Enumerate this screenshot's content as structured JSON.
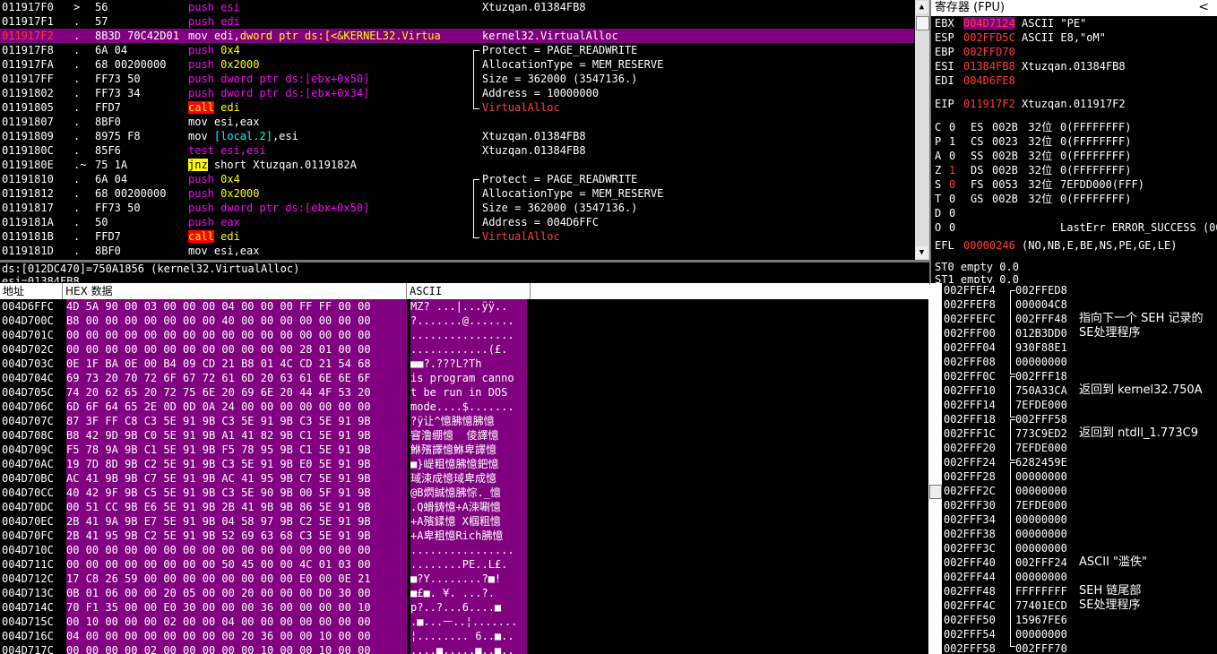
{
  "colors": {
    "selection": "#800080",
    "push": "#ff00ff",
    "arg": "#ffff00",
    "call_bg": "#ff0000",
    "reg_changed": "#ff3b3b"
  },
  "disasm": {
    "rows": [
      {
        "addr": "011917F0",
        "mk": ">",
        "hex": "56",
        "asm": [
          {
            "t": "push",
            "k": "push"
          },
          {
            "t": " esi",
            "k": "push"
          }
        ],
        "cmt": "Xtuzqan.01384FB8"
      },
      {
        "addr": "011917F1",
        "mk": ".",
        "hex": "57",
        "asm": [
          {
            "t": "push",
            "k": "push"
          },
          {
            "t": " edi",
            "k": "push"
          }
        ],
        "cmt": ""
      },
      {
        "addr": "011917F2",
        "mk": ".",
        "hex": "8B3D 70C42D01",
        "asm": [
          {
            "t": "mov edi,",
            "k": "mov"
          },
          {
            "t": "dword ptr ds:[<&KERNEL32.Virtua",
            "k": "mem"
          }
        ],
        "cmt": "kernel32.VirtualAlloc",
        "sel": true
      },
      {
        "addr": "011917F8",
        "mk": ".",
        "hex": "6A 04",
        "asm": [
          {
            "t": "push",
            "k": "push"
          },
          {
            "t": " 0x4",
            "k": "arg"
          }
        ],
        "cmt": "Protect = PAGE_READWRITE"
      },
      {
        "addr": "011917FA",
        "mk": ".",
        "hex": "68 00200000",
        "asm": [
          {
            "t": "push",
            "k": "push"
          },
          {
            "t": " 0x2000",
            "k": "arg"
          }
        ],
        "cmt": "AllocationType = MEM_RESERVE"
      },
      {
        "addr": "011917FF",
        "mk": ".",
        "hex": "FF73 50",
        "asm": [
          {
            "t": "push",
            "k": "push"
          },
          {
            "t": " dword ptr ds:[ebx+0x50]",
            "k": "push"
          }
        ],
        "cmt": "Size = 362000 (3547136.)"
      },
      {
        "addr": "01191802",
        "mk": ".",
        "hex": "FF73 34",
        "asm": [
          {
            "t": "push",
            "k": "push"
          },
          {
            "t": " dword ptr ds:[ebx+0x34]",
            "k": "push"
          }
        ],
        "cmt": "Address = 10000000"
      },
      {
        "addr": "01191805",
        "mk": ".",
        "hex": "FFD7",
        "asm": [
          {
            "t": "call",
            "k": "call"
          },
          {
            "t": " edi",
            "k": "arg"
          }
        ],
        "cmt": "VirtualAlloc",
        "cmtred": true
      },
      {
        "addr": "01191807",
        "mk": ".",
        "hex": "8BF0",
        "asm": [
          {
            "t": "mov esi,eax",
            "k": "mov"
          }
        ],
        "cmt": ""
      },
      {
        "addr": "01191809",
        "mk": ".",
        "hex": "8975 F8",
        "asm": [
          {
            "t": "mov ",
            "k": "mov"
          },
          {
            "t": "[local.2]",
            "k": "reg"
          },
          {
            "t": ",esi",
            "k": "mov"
          }
        ],
        "cmt": "Xtuzqan.01384FB8"
      },
      {
        "addr": "0119180C",
        "mk": ".",
        "hex": "85F6",
        "asm": [
          {
            "t": "test esi,esi",
            "k": "test"
          }
        ],
        "cmt": "Xtuzqan.01384FB8"
      },
      {
        "addr": "0119180E",
        "mk": ".~",
        "hex": "75 1A",
        "asm": [
          {
            "t": "jnz",
            "k": "jnz"
          },
          {
            "t": " short Xtuzqan.0119182A",
            "k": "mov"
          }
        ],
        "cmt": ""
      },
      {
        "addr": "01191810",
        "mk": ".",
        "hex": "6A 04",
        "asm": [
          {
            "t": "push",
            "k": "push"
          },
          {
            "t": " 0x4",
            "k": "arg"
          }
        ],
        "cmt": "Protect = PAGE_READWRITE"
      },
      {
        "addr": "01191812",
        "mk": ".",
        "hex": "68 00200000",
        "asm": [
          {
            "t": "push",
            "k": "push"
          },
          {
            "t": " 0x2000",
            "k": "arg"
          }
        ],
        "cmt": "AllocationType = MEM_RESERVE"
      },
      {
        "addr": "01191817",
        "mk": ".",
        "hex": "FF73 50",
        "asm": [
          {
            "t": "push",
            "k": "push"
          },
          {
            "t": " dword ptr ds:[ebx+0x50]",
            "k": "push"
          }
        ],
        "cmt": "Size = 362000 (3547136.)"
      },
      {
        "addr": "0119181A",
        "mk": ".",
        "hex": "50",
        "asm": [
          {
            "t": "push",
            "k": "push"
          },
          {
            "t": " eax",
            "k": "push"
          }
        ],
        "cmt": "Address = 004D6FFC"
      },
      {
        "addr": "0119181B",
        "mk": ".",
        "hex": "FFD7",
        "asm": [
          {
            "t": "call",
            "k": "call"
          },
          {
            "t": " edi",
            "k": "arg"
          }
        ],
        "cmt": "VirtualAlloc",
        "cmtred": true
      },
      {
        "addr": "0119181D",
        "mk": ".",
        "hex": "8BF0",
        "asm": [
          {
            "t": "mov esi,eax",
            "k": "mov"
          }
        ],
        "cmt": ""
      }
    ],
    "info_line1": "ds:[012DC470]=750A1856 (kernel32.VirtualAlloc)",
    "info_line2": "esi=01384FB8"
  },
  "registers": {
    "title": "寄存器 (FPU)",
    "collapse": "<",
    "gp": [
      {
        "n": "EBX",
        "v": "004D7124",
        "c": "ASCII \"PE\"",
        "sel": true
      },
      {
        "n": "ESP",
        "v": "002FFD5C",
        "c": "ASCII E8,\"oM\""
      },
      {
        "n": "EBP",
        "v": "002FFD70",
        "c": ""
      },
      {
        "n": "ESI",
        "v": "01384FB8",
        "c": "Xtuzqan.01384FB8"
      },
      {
        "n": "EDI",
        "v": "004D6FE8",
        "c": ""
      }
    ],
    "eip": {
      "n": "EIP",
      "v": "011917F2",
      "c": "Xtuzqan.011917F2"
    },
    "flags": [
      {
        "f": "C",
        "b": "0",
        "s": "ES",
        "v": "002B",
        "w": "32位",
        "l": "0(FFFFFFFF)"
      },
      {
        "f": "P",
        "b": "1",
        "s": "CS",
        "v": "0023",
        "w": "32位",
        "l": "0(FFFFFFFF)"
      },
      {
        "f": "A",
        "b": "0",
        "s": "SS",
        "v": "002B",
        "w": "32位",
        "l": "0(FFFFFFFF)"
      },
      {
        "f": "Z",
        "b": "1",
        "s": "DS",
        "v": "002B",
        "w": "32位",
        "l": "0(FFFFFFFF)",
        "red": true
      },
      {
        "f": "S",
        "b": "0",
        "s": "FS",
        "v": "0053",
        "w": "32位",
        "l": "7EFDD000(FFF)",
        "red": true
      },
      {
        "f": "T",
        "b": "0",
        "s": "GS",
        "v": "002B",
        "w": "32位",
        "l": "0(FFFFFFFF)"
      },
      {
        "f": "D",
        "b": "0",
        "s": "",
        "v": "",
        "w": "",
        "l": ""
      },
      {
        "f": "O",
        "b": "0",
        "s": "",
        "v": "",
        "w": "",
        "l": "LastErr ERROR_SUCCESS (00000000)"
      }
    ],
    "efl": {
      "n": "EFL",
      "v": "00000246",
      "c": "(NO,NB,E,BE,NS,PE,GE,LE)"
    },
    "st0": "ST0 empty 0.0",
    "st1": "ST1 empty 0.0"
  },
  "dump": {
    "col_addr": "地址",
    "col_hex": "HEX 数据",
    "col_ascii": "ASCII",
    "rows": [
      {
        "a": "004D6FFC",
        "h": "4D 5A 90 00 03 00 00 00 04 00 00 00 FF FF 00 00",
        "s": "MZ? ...|...ÿÿ.."
      },
      {
        "a": "004D700C",
        "h": "B8 00 00 00 00 00 00 00 40 00 00 00 00 00 00 00",
        "s": "?.......@......."
      },
      {
        "a": "004D701C",
        "h": "00 00 00 00 00 00 00 00 00 00 00 00 00 00 00 00",
        "s": "................"
      },
      {
        "a": "004D702C",
        "h": "00 00 00 00 00 00 00 00 00 00 00 00 28 01 00 00",
        "s": "............(£."
      },
      {
        "a": "004D703C",
        "h": "0E 1F BA 0E 00 B4 09 CD 21 B8 01 4C CD 21 54 68",
        "s": "■■?.???L?Th"
      },
      {
        "a": "004D704C",
        "h": "69 73 20 70 72 6F 67 72 61 6D 20 63 61 6E 6E 6F",
        "s": "is program canno"
      },
      {
        "a": "004D705C",
        "h": "74 20 62 65 20 72 75 6E 20 69 6E 20 44 4F 53 20",
        "s": "t be run in DOS "
      },
      {
        "a": "004D706C",
        "h": "6D 6F 64 65 2E 0D 0D 0A 24 00 00 00 00 00 00 00",
        "s": "mode....$......."
      },
      {
        "a": "004D707C",
        "h": "87 3F FF C8 C3 5E 91 9B C3 5E 91 9B C3 5E 91 9B",
        "s": "?ÿ让^憶胇憶胇憶"
      },
      {
        "a": "004D708C",
        "h": "B8 42 9D 9B C0 5E 91 9B A1 41 82 9B C1 5E 91 9B",
        "s": "窨澛绷憶  倰譯憶"
      },
      {
        "a": "004D709C",
        "h": "F5 78 9A 9B C1 5E 91 9B F5 78 95 9B C1 5E 91 9B",
        "s": "鮴殯譯憶鮴卑譯憶"
      },
      {
        "a": "004D70AC",
        "h": "19 7D 8D 9B C2 5E 91 9B C3 5E 91 9B E0 5E 91 9B",
        "s": "■}崼粗憶胇憶鈀憶"
      },
      {
        "a": "004D70BC",
        "h": "AC 41 9B 9B C7 5E 91 9B AC 41 95 9B C7 5E 91 9B",
        "s": "琙涑成憶琙卑成憶"
      },
      {
        "a": "004D70CC",
        "h": "40 42 9F 9B C5 5E 91 9B C3 5E 90 9B 00 5F 91 9B",
        "s": "@B熌鋮憶胇悰._憶"
      },
      {
        "a": "004D70DC",
        "h": "00 51 CC 9B E6 5E 91 9B 2B 41 9B 9B 86 5E 91 9B",
        "s": ".Q螖鋳憶+A涑唰憶"
      },
      {
        "a": "004D70EC",
        "h": "2B 41 9A 9B E7 5E 91 9B 04 58 97 9B C2 5E 91 9B",
        "s": "+A殯鍒憶 X椢粗憶"
      },
      {
        "a": "004D70FC",
        "h": "2B 41 95 9B C2 5E 91 9B 52 69 63 68 C3 5E 91 9B",
        "s": "+A卑粗憶Rich胇憶"
      },
      {
        "a": "004D710C",
        "h": "00 00 00 00 00 00 00 00 00 00 00 00 00 00 00 00",
        "s": "................"
      },
      {
        "a": "004D711C",
        "h": "00 00 00 00 00 00 00 00 50 45 00 00 4C 01 03 00",
        "s": "........PE..L£."
      },
      {
        "a": "004D712C",
        "h": "17 C8 26 59 00 00 00 00 00 00 00 00 E0 00 0E 21",
        "s": "■?Y........?■!"
      },
      {
        "a": "004D713C",
        "h": "0B 01 06 00 00 20 05 00 00 20 00 00 00 D0 30 00",
        "s": "■£■. ¥. ...?."
      },
      {
        "a": "004D714C",
        "h": "70 F1 35 00 00 E0 30 00 00 00 36 00 00 00 00 10",
        "s": "p?..?...6....■"
      },
      {
        "a": "004D715C",
        "h": "00 10 00 00 00 02 00 00 04 00 00 00 00 00 00 00",
        "s": ".■...ᅳ..¦......."
      },
      {
        "a": "004D716C",
        "h": "04 00 00 00 00 00 00 00 00 20 36 00 00 10 00 00",
        "s": "¦........ 6..■.."
      },
      {
        "a": "004D717C",
        "h": "00 00 00 00 02 00 00 00 00 00 10 00 00 10 00 00",
        "s": "....■.....■..■.."
      }
    ]
  },
  "stack": {
    "rows": [
      {
        "a": "002FFEF4",
        "v": "002FFED8",
        "c": ""
      },
      {
        "a": "002FFEF8",
        "v": "000004C8",
        "c": ""
      },
      {
        "a": "002FFEFC",
        "v": "002FFF48",
        "c": "指向下一个 SEH 记录的"
      },
      {
        "a": "002FFF00",
        "v": "012B3DD0",
        "c": "SE处理程序"
      },
      {
        "a": "002FFF04",
        "v": "930F88E1",
        "c": ""
      },
      {
        "a": "002FFF08",
        "v": "00000000",
        "c": ""
      },
      {
        "a": "002FFF0C",
        "v": "002FFF18",
        "c": ""
      },
      {
        "a": "002FFF10",
        "v": "750A33CA",
        "c": "返回到 kernel32.750A"
      },
      {
        "a": "002FFF14",
        "v": "7EFDE000",
        "c": ""
      },
      {
        "a": "002FFF18",
        "v": "002FFF58",
        "c": ""
      },
      {
        "a": "002FFF1C",
        "v": "773C9ED2",
        "c": "返回到 ntdll_1.773C9"
      },
      {
        "a": "002FFF20",
        "v": "7EFDE000",
        "c": ""
      },
      {
        "a": "002FFF24",
        "v": "6282459E",
        "c": ""
      },
      {
        "a": "002FFF28",
        "v": "00000000",
        "c": ""
      },
      {
        "a": "002FFF2C",
        "v": "00000000",
        "c": ""
      },
      {
        "a": "002FFF30",
        "v": "7EFDE000",
        "c": ""
      },
      {
        "a": "002FFF34",
        "v": "00000000",
        "c": ""
      },
      {
        "a": "002FFF38",
        "v": "00000000",
        "c": ""
      },
      {
        "a": "002FFF3C",
        "v": "00000000",
        "c": ""
      },
      {
        "a": "002FFF40",
        "v": "002FFF24",
        "c": "ASCII \"滥佚\""
      },
      {
        "a": "002FFF44",
        "v": "00000000",
        "c": ""
      },
      {
        "a": "002FFF48",
        "v": "FFFFFFFF",
        "c": "SEH 链尾部"
      },
      {
        "a": "002FFF4C",
        "v": "77401ECD",
        "c": "SE处理程序"
      },
      {
        "a": "002FFF50",
        "v": "15967FE6",
        "c": ""
      },
      {
        "a": "002FFF54",
        "v": "00000000",
        "c": ""
      },
      {
        "a": "002FFF58",
        "v": "002FFF70",
        "c": ""
      }
    ]
  }
}
